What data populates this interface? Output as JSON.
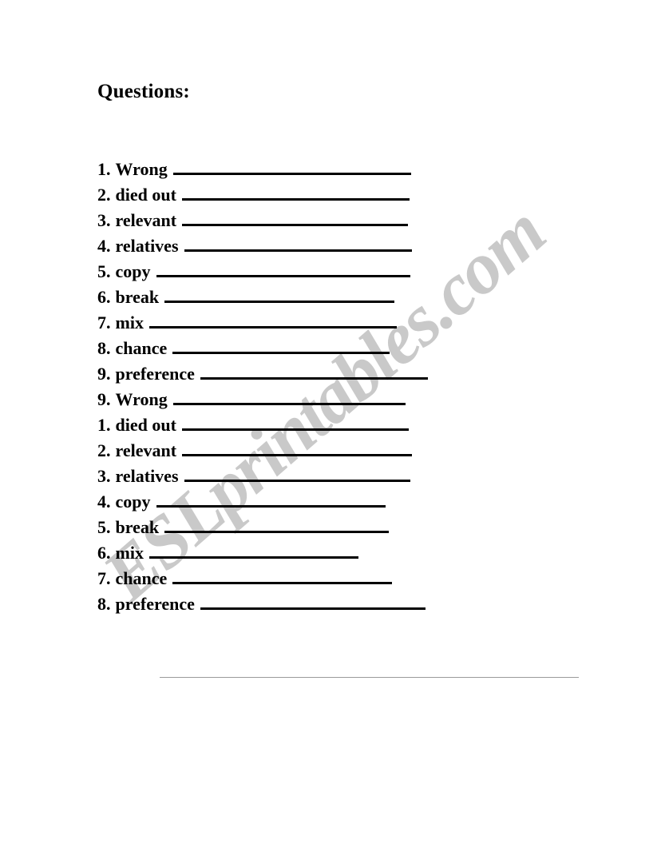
{
  "document": {
    "title": "Questions:",
    "watermark": "ESLprintables.com",
    "watermark_color": "#c9c9c9",
    "text_color": "#000000",
    "background_color": "#ffffff",
    "rule_color": "#9a9a9a"
  },
  "questions": [
    {
      "number": "1.",
      "word": "Wrong",
      "blank_width": 298
    },
    {
      "number": "2.",
      "word": "died out",
      "blank_width": 285
    },
    {
      "number": "3.",
      "word": "relevant",
      "blank_width": 283
    },
    {
      "number": "4.",
      "word": "relatives",
      "blank_width": 285
    },
    {
      "number": "5.",
      "word": "copy",
      "blank_width": 318
    },
    {
      "number": "6.",
      "word": "break",
      "blank_width": 288
    },
    {
      "number": "7.",
      "word": "mix",
      "blank_width": 310
    },
    {
      "number": "8.",
      "word": "chance",
      "blank_width": 272
    },
    {
      "number": "9.",
      "word": "preference",
      "blank_width": 285
    },
    {
      "number": "9.",
      "word": "Wrong",
      "blank_width": 291
    },
    {
      "number": "1.",
      "word": "died out",
      "blank_width": 284
    },
    {
      "number": "2.",
      "word": "relevant",
      "blank_width": 288
    },
    {
      "number": "3.",
      "word": "relatives",
      "blank_width": 283
    },
    {
      "number": "4.",
      "word": "copy",
      "blank_width": 287
    },
    {
      "number": "5.",
      "word": "break",
      "blank_width": 281
    },
    {
      "number": "6.",
      "word": "mix",
      "blank_width": 262
    },
    {
      "number": "7.",
      "word": "chance",
      "blank_width": 275
    },
    {
      "number": "8.",
      "word": "preference",
      "blank_width": 282
    }
  ]
}
